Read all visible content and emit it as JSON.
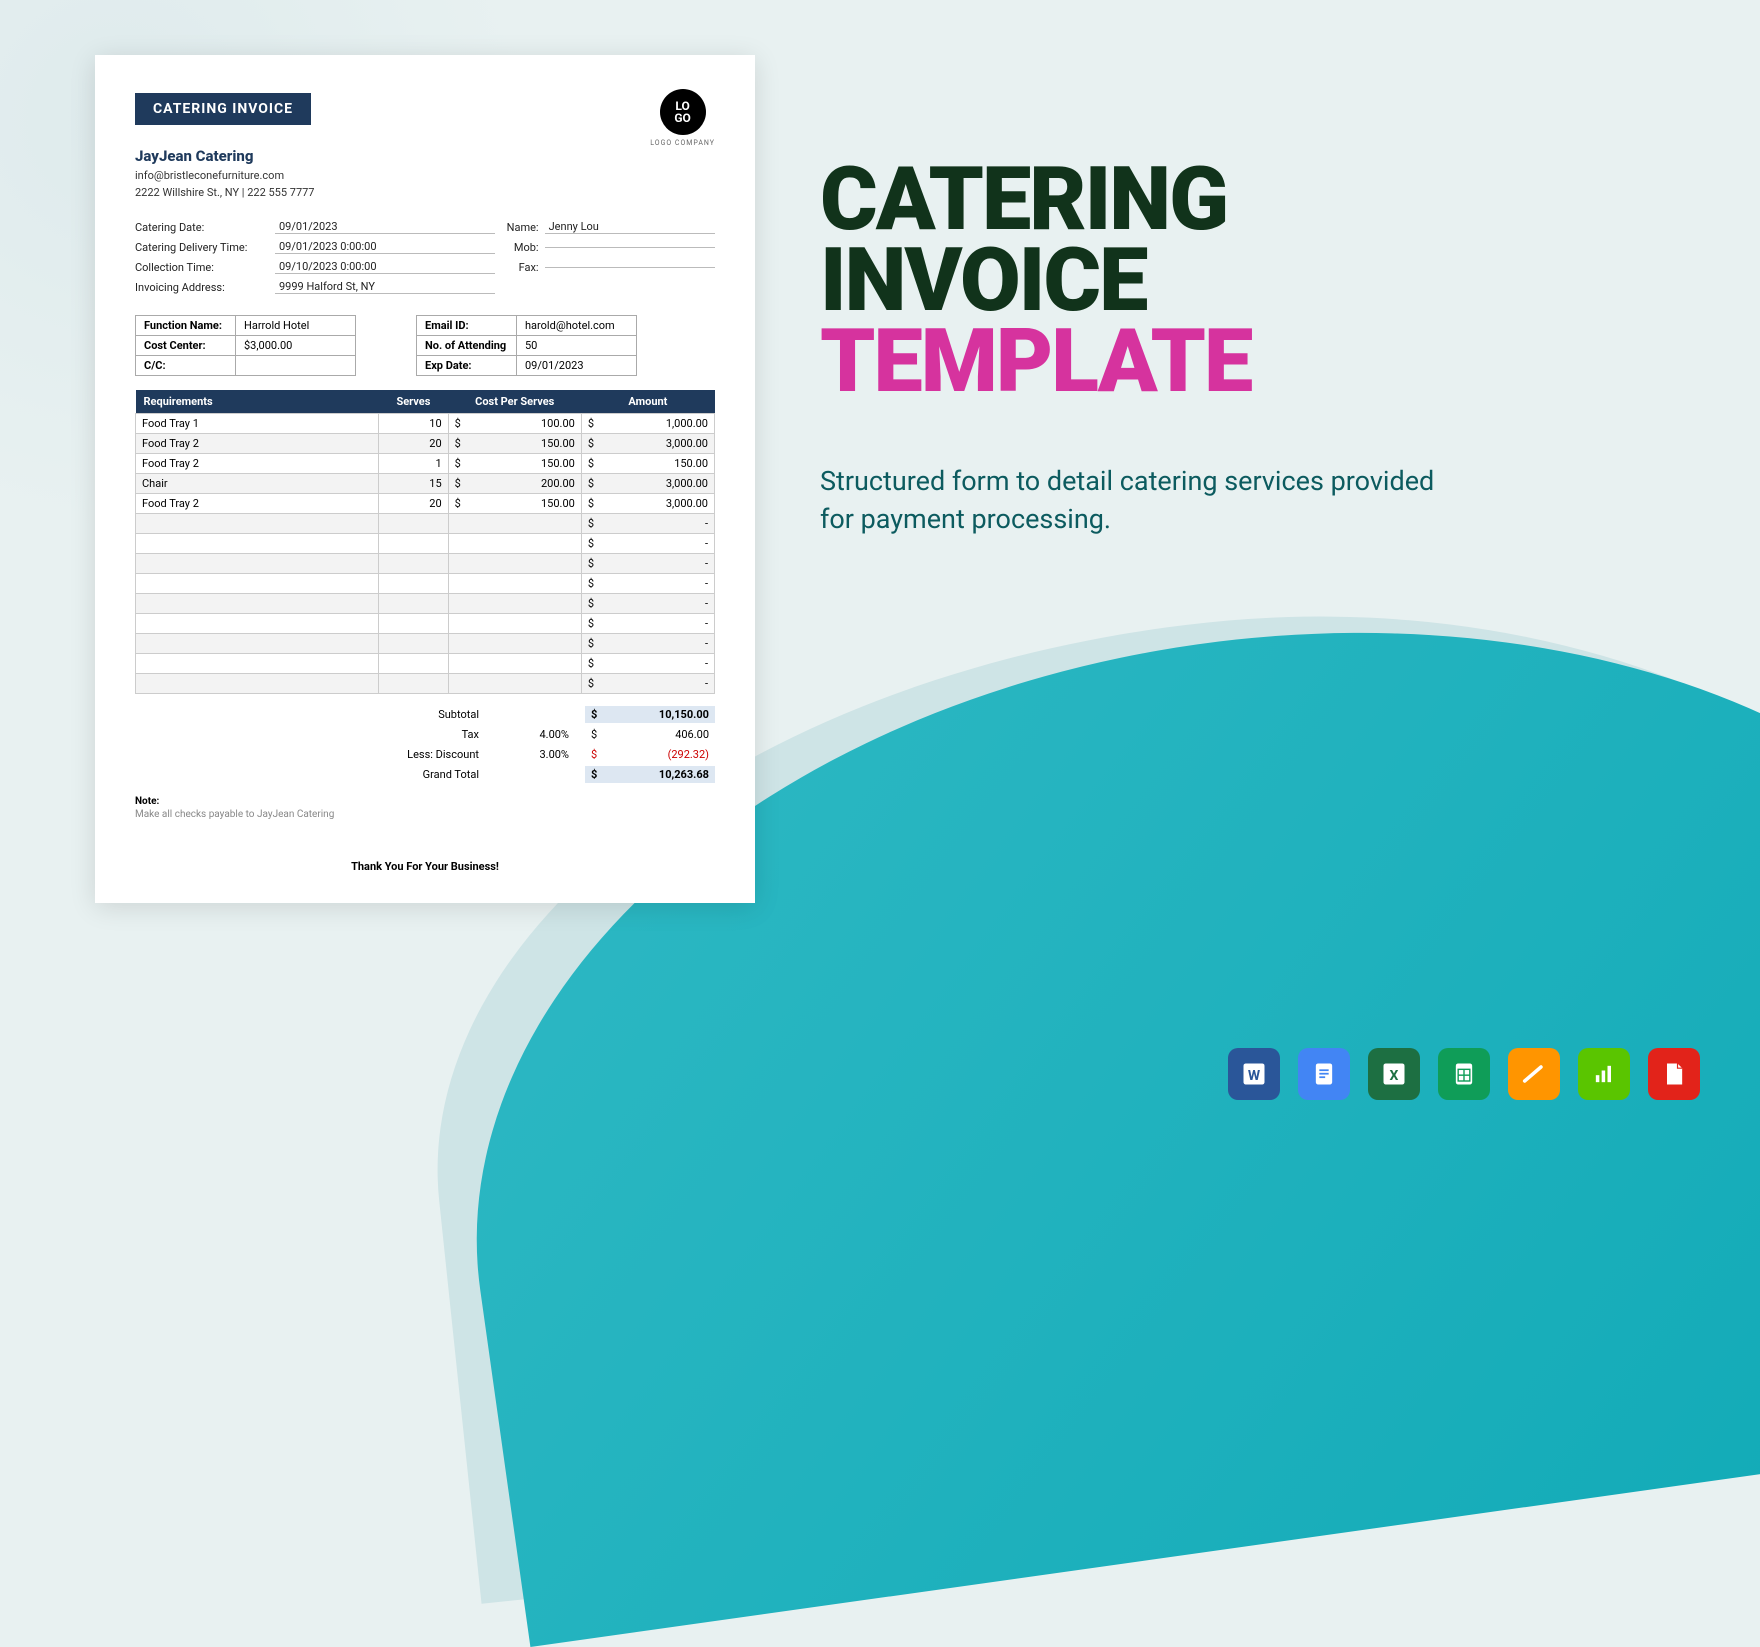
{
  "badge": "CATERING INVOICE",
  "logo": {
    "line1": "LO",
    "line2": "GO",
    "sub": "LOGO COMPANY"
  },
  "company": {
    "name": "JayJean Catering",
    "email": "info@bristleconefurniture.com",
    "address": "2222 Willshire St., NY | 222 555 7777"
  },
  "info_left": [
    {
      "label": "Catering Date:",
      "value": "09/01/2023"
    },
    {
      "label": "Catering Delivery Time:",
      "value": "09/01/2023 0:00:00"
    },
    {
      "label": "Collection Time:",
      "value": "09/10/2023 0:00:00"
    },
    {
      "label": "Invoicing Address:",
      "value": "9999 Halford St, NY"
    }
  ],
  "info_right": [
    {
      "label": "Name:",
      "value": "Jenny Lou"
    },
    {
      "label": "Mob:",
      "value": ""
    },
    {
      "label": "Fax:",
      "value": ""
    }
  ],
  "box1": [
    {
      "label": "Function Name:",
      "value": "Harrold Hotel"
    },
    {
      "label": "Cost Center:",
      "value": "$3,000.00"
    },
    {
      "label": "C/C:",
      "value": ""
    }
  ],
  "box2": [
    {
      "label": "Email ID:",
      "value": "harold@hotel.com"
    },
    {
      "label": "No. of Attending",
      "value": "50"
    },
    {
      "label": "Exp Date:",
      "value": "09/01/2023"
    }
  ],
  "items_header": {
    "req": "Requirements",
    "serves": "Serves",
    "cost": "Cost Per Serves",
    "amount": "Amount"
  },
  "items": [
    {
      "req": "Food Tray 1",
      "serves": "10",
      "cost": "100.00",
      "amount": "1,000.00"
    },
    {
      "req": "Food Tray 2",
      "serves": "20",
      "cost": "150.00",
      "amount": "3,000.00"
    },
    {
      "req": "Food Tray 2",
      "serves": "1",
      "cost": "150.00",
      "amount": "150.00"
    },
    {
      "req": "Chair",
      "serves": "15",
      "cost": "200.00",
      "amount": "3,000.00"
    },
    {
      "req": "Food Tray 2",
      "serves": "20",
      "cost": "150.00",
      "amount": "3,000.00"
    },
    {
      "req": "",
      "serves": "",
      "cost": "",
      "amount": "-"
    },
    {
      "req": "",
      "serves": "",
      "cost": "",
      "amount": "-"
    },
    {
      "req": "",
      "serves": "",
      "cost": "",
      "amount": "-"
    },
    {
      "req": "",
      "serves": "",
      "cost": "",
      "amount": "-"
    },
    {
      "req": "",
      "serves": "",
      "cost": "",
      "amount": "-"
    },
    {
      "req": "",
      "serves": "",
      "cost": "",
      "amount": "-"
    },
    {
      "req": "",
      "serves": "",
      "cost": "",
      "amount": "-"
    },
    {
      "req": "",
      "serves": "",
      "cost": "",
      "amount": "-"
    },
    {
      "req": "",
      "serves": "",
      "cost": "",
      "amount": "-"
    }
  ],
  "totals": {
    "subtotal_label": "Subtotal",
    "subtotal": "10,150.00",
    "tax_label": "Tax",
    "tax_pct": "4.00%",
    "tax_val": "406.00",
    "disc_label": "Less: Discount",
    "disc_pct": "3.00%",
    "disc_val": "(292.32)",
    "grand_label": "Grand Total",
    "grand_val": "10,263.68"
  },
  "note": {
    "label": "Note:",
    "text": "Make all checks payable to JayJean Catering"
  },
  "thanks": "Thank You For Your Business!",
  "right": {
    "title1": "CATERING",
    "title2": "INVOICE",
    "title3": "TEMPLATE",
    "desc": "Structured form to detail catering services provided for payment processing."
  },
  "formats": [
    "word",
    "gdoc",
    "excel",
    "sheet",
    "pages",
    "numbers",
    "pdf"
  ]
}
